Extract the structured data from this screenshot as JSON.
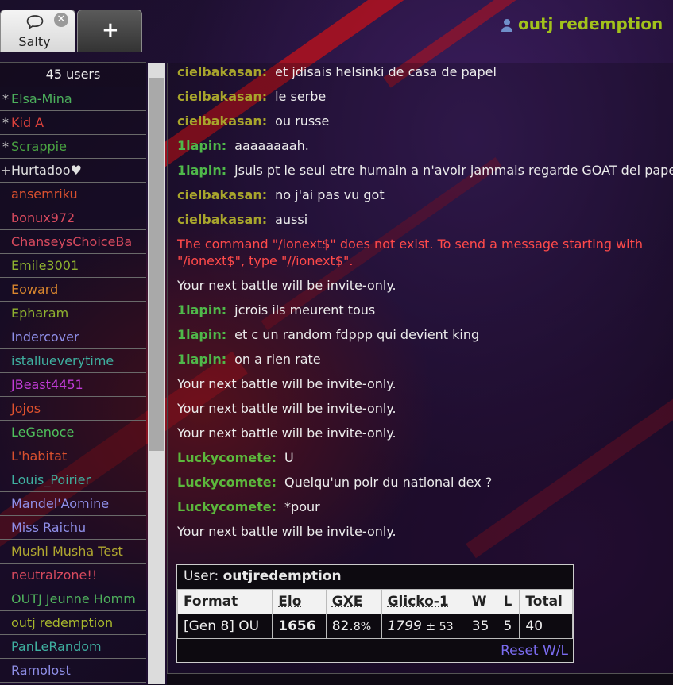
{
  "header": {
    "tabs": [
      {
        "label": "Salty",
        "icon": "chat-bubble-icon",
        "close": "✕"
      },
      {
        "label": "+",
        "icon": "plus-icon"
      }
    ],
    "username": "outj redemption"
  },
  "sidebar": {
    "user_count": "45 users",
    "users": [
      {
        "rank": "*",
        "name": "Elsa-Mina",
        "color": "#4cb05c"
      },
      {
        "rank": "*",
        "name": "Kid A",
        "color": "#d9413b"
      },
      {
        "rank": "*",
        "name": "Scrappie",
        "color": "#4aa442"
      },
      {
        "rank": "+",
        "name": "Hurtadoo♥",
        "color": "#e0e0e0"
      },
      {
        "rank": " ",
        "name": "ansemriku",
        "color": "#d9502e"
      },
      {
        "rank": " ",
        "name": "bonux972",
        "color": "#d84a5e"
      },
      {
        "rank": " ",
        "name": "ChanseysChoiceBa",
        "color": "#d84a5e"
      },
      {
        "rank": " ",
        "name": "Emile3001",
        "color": "#8fb22f"
      },
      {
        "rank": " ",
        "name": "Eoward",
        "color": "#d9862e"
      },
      {
        "rank": " ",
        "name": "Epharam",
        "color": "#8fb22f"
      },
      {
        "rank": " ",
        "name": "Indercover",
        "color": "#8f8fe8"
      },
      {
        "rank": " ",
        "name": "istallueverytime",
        "color": "#3fb0a0"
      },
      {
        "rank": " ",
        "name": "JBeast4451",
        "color": "#c23cd8"
      },
      {
        "rank": " ",
        "name": "Jojos",
        "color": "#e0522e"
      },
      {
        "rank": " ",
        "name": "LeGenoce",
        "color": "#4fc05c"
      },
      {
        "rank": " ",
        "name": "L'habitat",
        "color": "#d9502e"
      },
      {
        "rank": " ",
        "name": "Louis_Poirier",
        "color": "#3fb0a0"
      },
      {
        "rank": " ",
        "name": "Mandel'Aomine",
        "color": "#8f8fe8"
      },
      {
        "rank": " ",
        "name": "Miss Raichu",
        "color": "#8f8fe8"
      },
      {
        "rank": " ",
        "name": "Mushi Musha Test",
        "color": "#b0a830"
      },
      {
        "rank": " ",
        "name": "neutralzone!!",
        "color": "#d84a5e"
      },
      {
        "rank": " ",
        "name": "OUTJ Jeunne Homm",
        "color": "#4fb05c"
      },
      {
        "rank": " ",
        "name": "outj redemption",
        "color": "#a8b82c"
      },
      {
        "rank": " ",
        "name": "PanLeRandom",
        "color": "#3fb0a0"
      },
      {
        "rank": " ",
        "name": "Ramolost",
        "color": "#8f8fe8"
      }
    ]
  },
  "chat": {
    "messages": [
      {
        "type": "user",
        "name": "cielbakasan:",
        "color": "#a8a52c",
        "text": "et jdisais helsinki de casa de papel"
      },
      {
        "type": "user",
        "name": "cielbakasan:",
        "color": "#a8a52c",
        "text": "le serbe"
      },
      {
        "type": "user",
        "name": "cielbakasan:",
        "color": "#a8a52c",
        "text": "ou russe"
      },
      {
        "type": "user",
        "name": "1lapin:",
        "color": "#4fb84a",
        "text": "aaaaaaaah."
      },
      {
        "type": "user-wrap",
        "name": "1lapin:",
        "color": "#4fb84a",
        "text": "jsuis pt le seul etre humain a n'avoir jammais regarde GOAT del papel"
      },
      {
        "type": "user",
        "name": "cielbakasan:",
        "color": "#a8a52c",
        "text": "no j'ai pas vu got"
      },
      {
        "type": "user",
        "name": "cielbakasan:",
        "color": "#a8a52c",
        "text": "aussi"
      },
      {
        "type": "error",
        "text": "The command \"/ionext$\" does not exist. To send a message starting with \"/ionext$\", type \"//ionext$\"."
      },
      {
        "type": "system",
        "text": "Your next battle will be invite-only."
      },
      {
        "type": "user",
        "name": "1lapin:",
        "color": "#4fb84a",
        "text": "jcrois ils meurent tous"
      },
      {
        "type": "user",
        "name": "1lapin:",
        "color": "#4fb84a",
        "text": "et c un random fdppp qui devient king"
      },
      {
        "type": "user",
        "name": "1lapin:",
        "color": "#4fb84a",
        "text": "on a rien rate"
      },
      {
        "type": "system",
        "text": "Your next battle will be invite-only."
      },
      {
        "type": "system",
        "text": "Your next battle will be invite-only."
      },
      {
        "type": "system",
        "text": "Your next battle will be invite-only."
      },
      {
        "type": "user",
        "name": "Luckycomete:",
        "color": "#5cb83c",
        "text": "U"
      },
      {
        "type": "user",
        "name": "Luckycomete:",
        "color": "#5cb83c",
        "text": "Quelqu'un poir du national dex ?"
      },
      {
        "type": "user",
        "name": "Luckycomete:",
        "color": "#5cb83c",
        "text": "*pour"
      },
      {
        "type": "system",
        "text": "Your next battle will be invite-only."
      }
    ]
  },
  "stats": {
    "user_label": "User:",
    "user_name": "outjredemption",
    "headers": [
      "Format",
      "Elo",
      "GXE",
      "Glicko-1",
      "W",
      "L",
      "Total"
    ],
    "row": {
      "format": "[Gen 8] OU",
      "elo": "1656",
      "gxe_int": "82.",
      "gxe_dec": "8%",
      "glicko": "1799",
      "glicko_dev": "± 53",
      "w": "35",
      "l": "5",
      "total": "40"
    },
    "reset_label": "Reset W/L"
  }
}
